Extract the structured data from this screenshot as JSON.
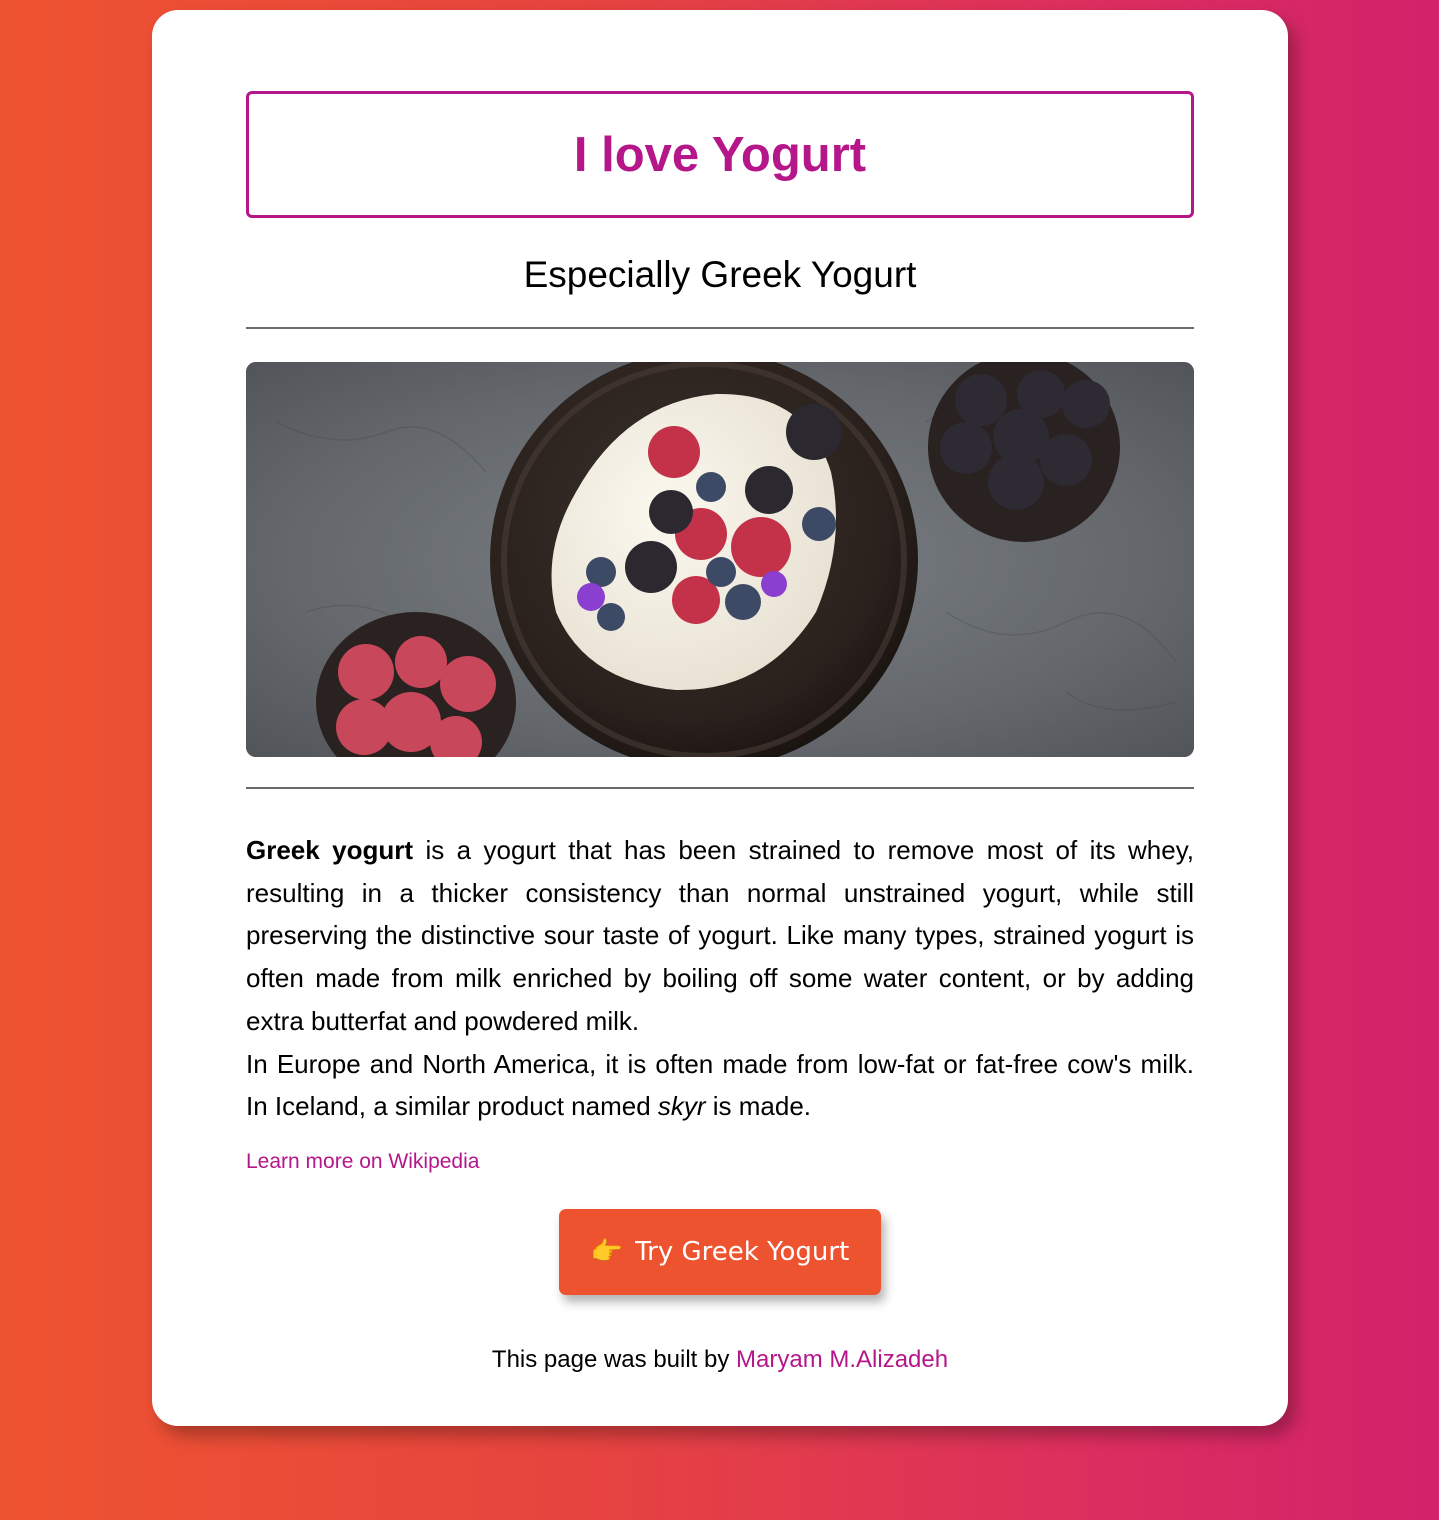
{
  "card": {
    "title": "I love Yogurt",
    "subtitle": "Especially Greek Yogurt",
    "image_alt": "Greek yogurt with berries",
    "description": {
      "bold_term": "Greek yogurt",
      "part1": " is a yogurt that has been strained to remove most of its whey, resulting in a thicker consistency than normal unstrained yogurt, while still preserving the distinctive sour taste of yogurt. Like many types, strained yogurt is often made from milk enriched by boiling off some water content, or by adding extra butterfat and powdered milk.",
      "part2": "In Europe and North America, it is often made from low-fat or fat-free cow's milk. In Iceland, a similar product named ",
      "italic_term": "skyr",
      "part3": " is made."
    },
    "wiki_link": "Learn more on Wikipedia",
    "cta": {
      "icon": "👉",
      "label": "Try Greek Yogurt"
    },
    "footer": {
      "text": "This page was built by ",
      "author": "Maryam M.Alizadeh"
    }
  },
  "colors": {
    "accent": "#b5168a",
    "button": "#ee5330",
    "gradient_left": "#ee5330",
    "gradient_right": "#d2226a"
  }
}
